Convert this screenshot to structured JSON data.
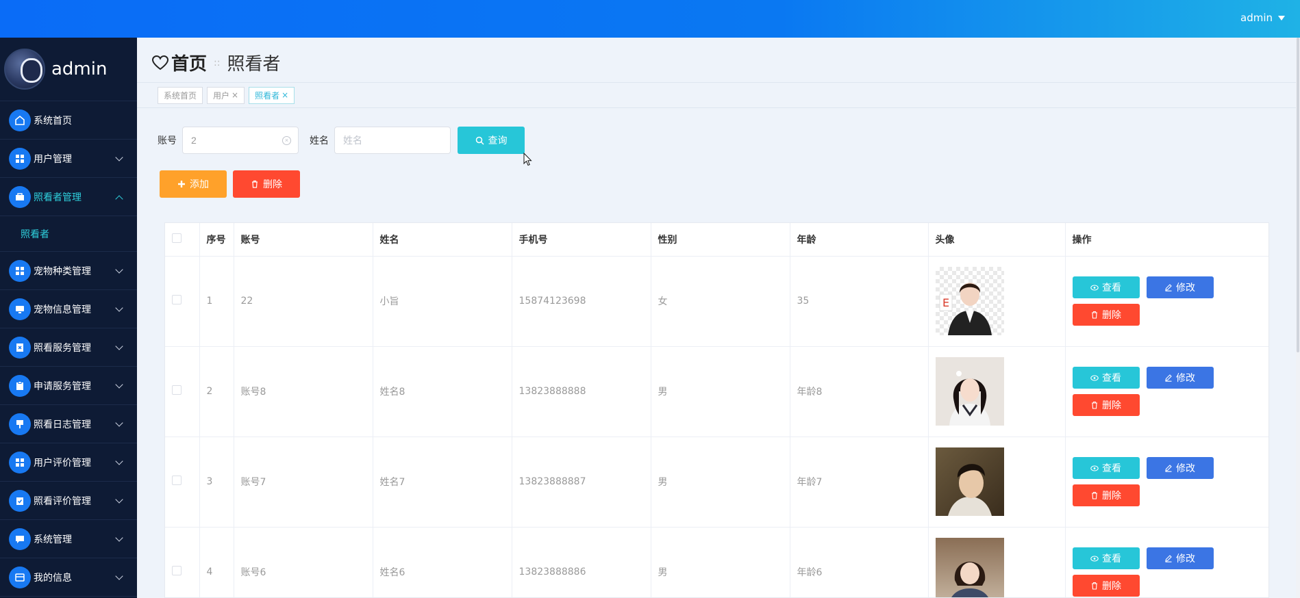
{
  "topbar": {
    "user": "admin"
  },
  "sidebar": {
    "user_name": "admin",
    "items": [
      {
        "label": "系统首页",
        "icon": "home-icon",
        "expand": false
      },
      {
        "label": "用户管理",
        "icon": "grid-icon",
        "expand": true
      },
      {
        "label": "照看者管理",
        "icon": "briefcase-icon",
        "expand": true,
        "active": true
      },
      {
        "label": "宠物种类管理",
        "icon": "grid-icon",
        "expand": true
      },
      {
        "label": "宠物信息管理",
        "icon": "monitor-icon",
        "expand": true
      },
      {
        "label": "照看服务管理",
        "icon": "doc-x-icon",
        "expand": true
      },
      {
        "label": "申请服务管理",
        "icon": "clipboard-icon",
        "expand": true
      },
      {
        "label": "照看日志管理",
        "icon": "brush-icon",
        "expand": true
      },
      {
        "label": "用户评价管理",
        "icon": "grid-icon",
        "expand": true
      },
      {
        "label": "照看评价管理",
        "icon": "clipboard-check-icon",
        "expand": true
      },
      {
        "label": "系统管理",
        "icon": "chat-icon",
        "expand": true
      },
      {
        "label": "我的信息",
        "icon": "wallet-icon",
        "expand": true
      }
    ],
    "submenu": {
      "label": "照看者"
    }
  },
  "header": {
    "home": "首页",
    "current": "照看者"
  },
  "tabs": [
    {
      "label": "系统首页",
      "closable": false
    },
    {
      "label": "用户",
      "closable": true
    },
    {
      "label": "照看者",
      "closable": true,
      "active": true
    }
  ],
  "search": {
    "account_label": "账号",
    "account_value": "2",
    "name_label": "姓名",
    "name_placeholder": "姓名",
    "query_label": "查询"
  },
  "actions": {
    "add_label": "添加",
    "delete_label": "删除"
  },
  "table": {
    "headers": [
      "序号",
      "账号",
      "姓名",
      "手机号",
      "性别",
      "年龄",
      "头像",
      "操作"
    ],
    "rows": [
      {
        "no": "1",
        "account": "22",
        "name": "小旨",
        "phone": "15874123698",
        "gender": "女",
        "age": "35"
      },
      {
        "no": "2",
        "account": "账号8",
        "name": "姓名8",
        "phone": "13823888888",
        "gender": "男",
        "age": "年龄8"
      },
      {
        "no": "3",
        "account": "账号7",
        "name": "姓名7",
        "phone": "13823888887",
        "gender": "男",
        "age": "年龄7"
      },
      {
        "no": "4",
        "account": "账号6",
        "name": "姓名6",
        "phone": "13823888886",
        "gender": "男",
        "age": "年龄6"
      }
    ],
    "ops": {
      "view": "查看",
      "edit": "修改",
      "delete": "删除"
    }
  },
  "colors": {
    "accent": "#27c6d8",
    "edit": "#3b75e4",
    "danger": "#ff4930",
    "warn": "#ffa12a",
    "sidebar": "#0e1b35"
  }
}
